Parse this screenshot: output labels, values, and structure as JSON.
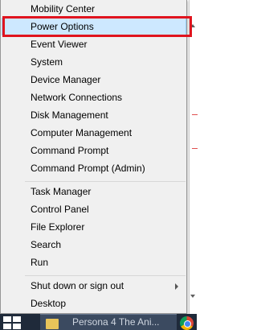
{
  "menu": {
    "items": [
      {
        "label": "Mobility Center"
      },
      {
        "label": "Power Options"
      },
      {
        "label": "Event Viewer"
      },
      {
        "label": "System"
      },
      {
        "label": "Device Manager"
      },
      {
        "label": "Network Connections"
      },
      {
        "label": "Disk Management"
      },
      {
        "label": "Computer Management"
      },
      {
        "label": "Command Prompt"
      },
      {
        "label": "Command Prompt (Admin)"
      },
      {
        "label": "Task Manager"
      },
      {
        "label": "Control Panel"
      },
      {
        "label": "File Explorer"
      },
      {
        "label": "Search"
      },
      {
        "label": "Run"
      },
      {
        "label": "Shut down or sign out"
      },
      {
        "label": "Desktop"
      }
    ],
    "highlighted_item": "Power Options",
    "annotation_color": "#e0141e"
  },
  "taskbar": {
    "app_label": "Persona 4 The Ani..."
  }
}
